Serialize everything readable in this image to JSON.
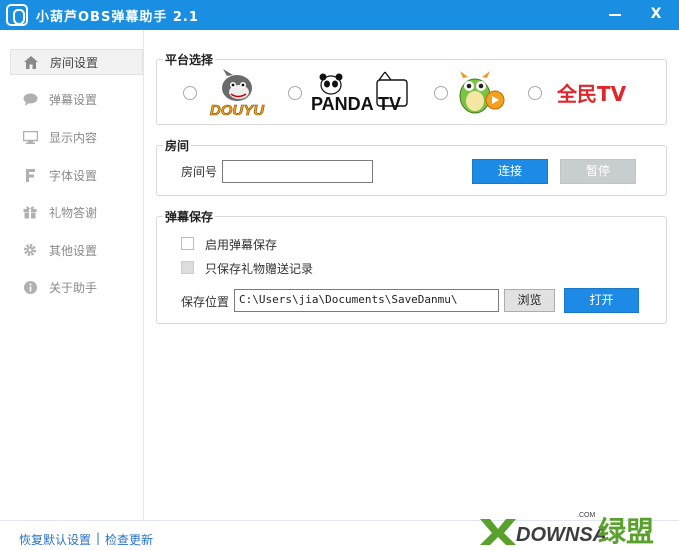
{
  "window": {
    "title": "小葫芦OBS弹幕助手 2.1",
    "minimize_label": "",
    "close_label": "X"
  },
  "sidebar": {
    "items": [
      {
        "label": "房间设置",
        "icon": "home-icon",
        "active": true
      },
      {
        "label": "弹幕设置",
        "icon": "chat-bubble-icon",
        "active": false
      },
      {
        "label": "显示内容",
        "icon": "monitor-icon",
        "active": false
      },
      {
        "label": "字体设置",
        "icon": "font-icon",
        "active": false
      },
      {
        "label": "礼物答谢",
        "icon": "gift-icon",
        "active": false
      },
      {
        "label": "其他设置",
        "icon": "gear-icon",
        "active": false
      },
      {
        "label": "关于助手",
        "icon": "info-icon",
        "active": false
      }
    ]
  },
  "platform": {
    "title": "平台选择",
    "options": [
      {
        "name": "Douyu",
        "logo_text": "DOUYU",
        "selected": false
      },
      {
        "name": "Panda TV",
        "logo_text": "PANDA TV",
        "selected": false
      },
      {
        "name": "Longzhu",
        "logo_text": "",
        "selected": false
      },
      {
        "name": "Quanmin TV",
        "logo_text": "全民TV",
        "selected": false
      }
    ]
  },
  "room": {
    "title": "房间",
    "room_label": "房间号",
    "room_value": "",
    "connect_label": "连接",
    "pause_label": "暂停"
  },
  "save": {
    "title": "弹幕保存",
    "enable_label": "启用弹幕保存",
    "enable_checked": false,
    "gift_only_label": "只保存礼物赠送记录",
    "gift_only_checked": false,
    "path_label": "保存位置",
    "path_value": "C:\\Users\\jia\\Documents\\SaveDanmu\\",
    "browse_label": "浏览",
    "open_label": "打开"
  },
  "footer": {
    "reset_label": "恢复默认设置",
    "separator": "|",
    "update_label": "检查更新"
  },
  "watermark": {
    "text": "DOWNSA",
    "com": ".COM",
    "chinese": "绿盟"
  },
  "colors": {
    "accent": "#1a8ee0",
    "link": "#2a73c5",
    "douyu_orange": "#f5a11b",
    "quanmin_red": "#e0262b"
  }
}
